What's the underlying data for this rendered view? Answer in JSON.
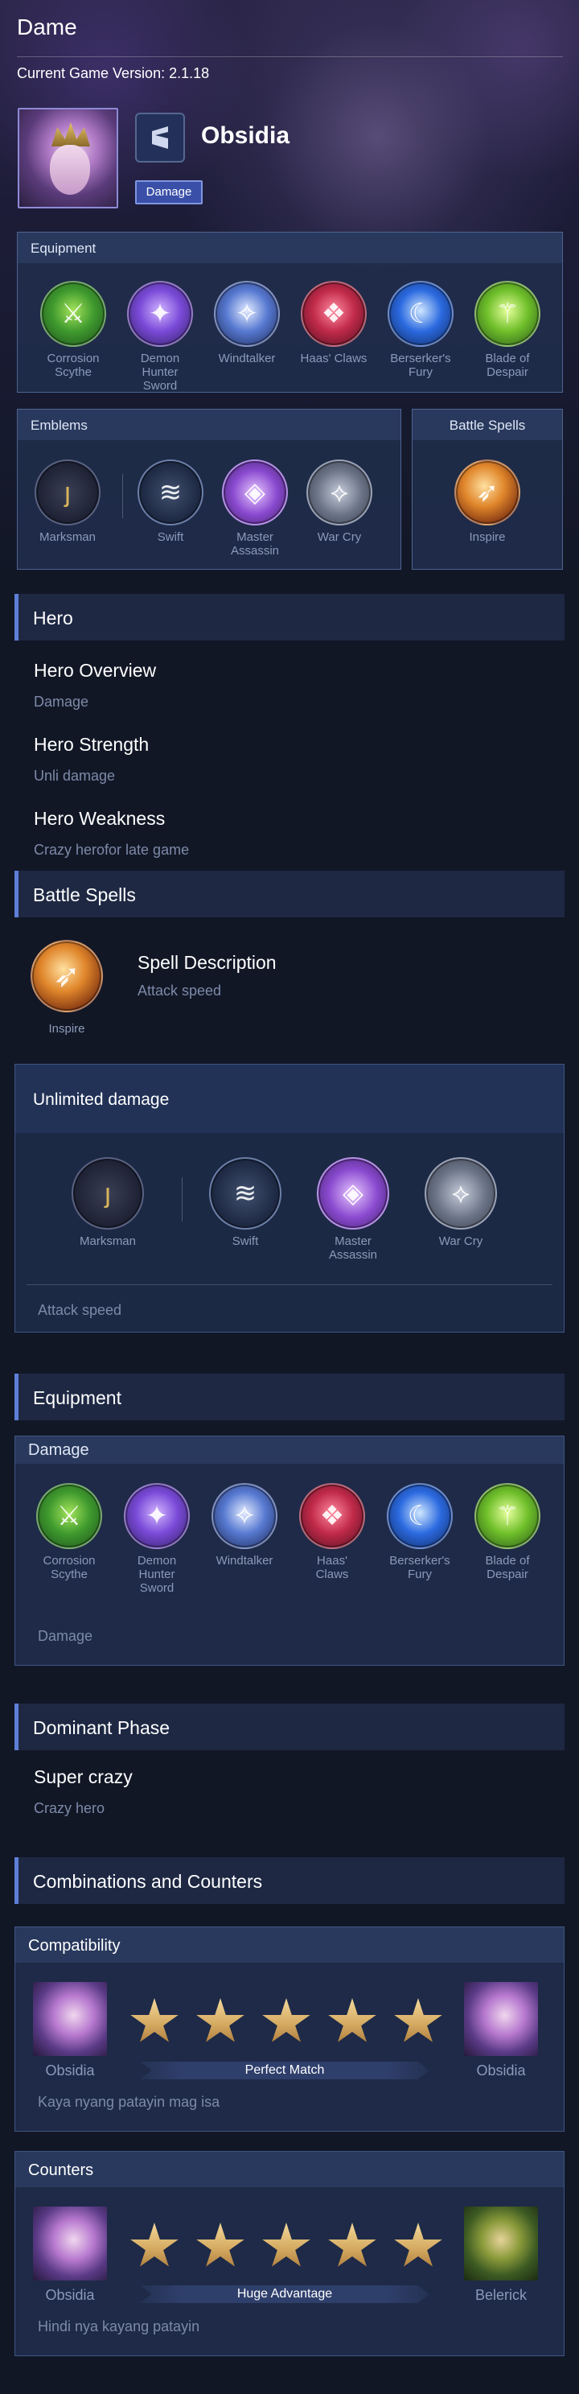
{
  "page_title": "Dame",
  "version": "Current Game Version: 2.1.18",
  "hero": {
    "name": "Obsidia",
    "role": "Damage"
  },
  "top": {
    "equipment_header": "Equipment",
    "equipment": [
      {
        "label": "Corrosion Scythe",
        "icon": "corrosion-scythe-icon",
        "color": "#3f9a2e"
      },
      {
        "label": "Demon Hunter Sword",
        "icon": "demon-hunter-sword-icon",
        "color": "#7a4ad8"
      },
      {
        "label": "Windtalker",
        "icon": "windtalker-icon",
        "color": "#5779d1"
      },
      {
        "label": "Haas' Claws",
        "icon": "haas-claws-icon",
        "color": "#c12a4a"
      },
      {
        "label": "Berserker's Fury",
        "icon": "berserkers-fury-icon",
        "color": "#2b6ae0"
      },
      {
        "label": "Blade of Despair",
        "icon": "blade-of-despair-icon",
        "color": "#6fbf2a"
      }
    ],
    "emblems_header": "Emblems",
    "emblems": [
      {
        "label": "Marksman",
        "icon": "marksman-icon"
      },
      {
        "label": "Swift",
        "icon": "swift-icon"
      },
      {
        "label": "Master Assassin",
        "icon": "master-assassin-icon"
      },
      {
        "label": "War Cry",
        "icon": "war-cry-icon"
      }
    ],
    "spells_header": "Battle Spells",
    "spell": {
      "label": "Inspire",
      "icon": "inspire-icon"
    }
  },
  "hero_section": {
    "title": "Hero",
    "overview_title": "Hero Overview",
    "overview": "Damage",
    "strength_title": "Hero Strength",
    "strength": "Unli damage",
    "weakness_title": "Hero Weakness",
    "weakness": "Crazy herofor late game"
  },
  "spells_section": {
    "title": "Battle Spells",
    "spell_label": "Inspire",
    "desc_title": "Spell Description",
    "desc": "Attack speed"
  },
  "emblem_card": {
    "title": "Unlimited damage",
    "items": [
      {
        "label": "Marksman"
      },
      {
        "label": "Swift"
      },
      {
        "label": "Master Assassin"
      },
      {
        "label": "War Cry"
      }
    ],
    "note": "Attack speed"
  },
  "equipment_section": {
    "title": "Equipment",
    "card_title": "Damage",
    "items": [
      {
        "label": "Corrosion Scythe"
      },
      {
        "label": "Demon Hunter Sword"
      },
      {
        "label": "Windtalker"
      },
      {
        "label": "Haas' Claws"
      },
      {
        "label": "Berserker's Fury"
      },
      {
        "label": "Blade of Despair"
      }
    ],
    "note": "Damage"
  },
  "dominant_section": {
    "title": "Dominant Phase",
    "heading": "Super crazy",
    "desc": "Crazy hero"
  },
  "combos_section": {
    "title": "Combinations and Counters",
    "compat": {
      "title": "Compatibility",
      "left_name": "Obsidia",
      "right_name": "Obsidia",
      "stars": 5,
      "rating": "Perfect Match",
      "note": "Kaya nyang patayin mag isa"
    },
    "counters": {
      "title": "Counters",
      "left_name": "Obsidia",
      "right_name": "Belerick",
      "stars": 5,
      "rating": "Huge Advantage",
      "note": "Hindi nya kayang patayin"
    }
  }
}
